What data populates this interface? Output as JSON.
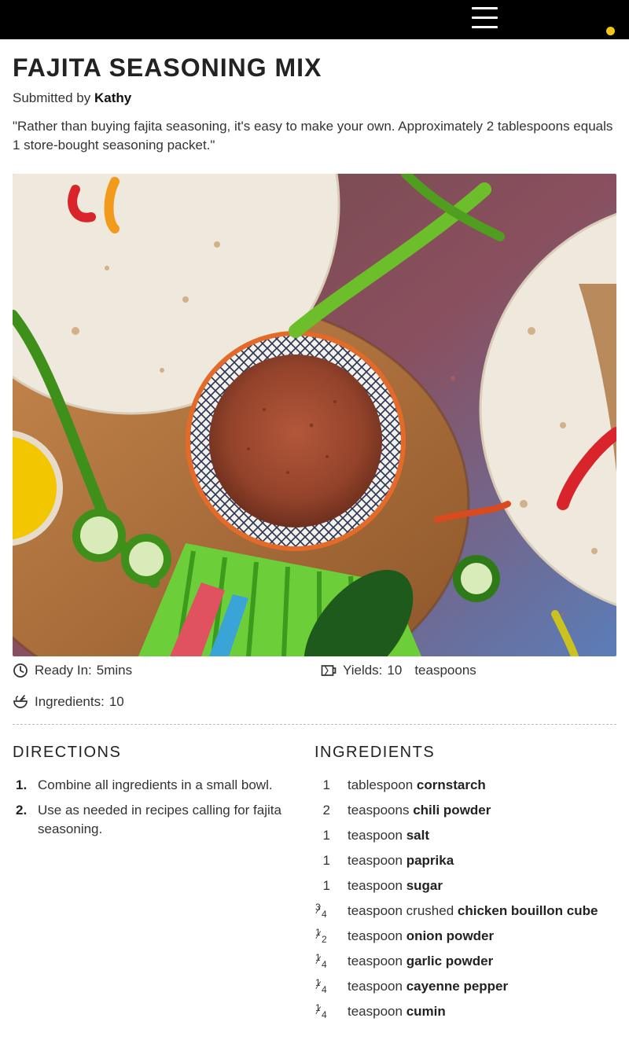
{
  "header": {
    "menu_icon": "hamburger-menu-icon",
    "accent_color": "#f5c518"
  },
  "recipe": {
    "title": "FAJITA SEASONING MIX",
    "submitted_by_label": "Submitted by",
    "author": "Kathy",
    "description": "\"Rather than buying fajita seasoning, it's easy to make your own. Approximately 2 tablespoons equals 1 store-bought seasoning packet.\"",
    "image_icon": "recipe-photo"
  },
  "meta": {
    "ready_in_label": "Ready In:",
    "ready_in_value": "5mins",
    "yields_label": "Yields:",
    "yields_value": "10",
    "yields_unit": "teaspoons",
    "ingredients_label": "Ingredients:",
    "ingredients_value": "10"
  },
  "directions": {
    "heading": "DIRECTIONS",
    "steps": [
      {
        "num": "1.",
        "text": "Combine all ingredients in a small bowl."
      },
      {
        "num": "2.",
        "text": "Use as needed in recipes calling for fajita seasoning."
      }
    ]
  },
  "ingredients": {
    "heading": "INGREDIENTS",
    "items": [
      {
        "qty": "1",
        "unit": "tablespoon",
        "name": "cornstarch"
      },
      {
        "qty": "2",
        "unit": "teaspoons",
        "name": "chili powder"
      },
      {
        "qty": "1",
        "unit": "teaspoon",
        "name": "salt"
      },
      {
        "qty": "1",
        "unit": "teaspoon",
        "name": "paprika"
      },
      {
        "qty": "1",
        "unit": "teaspoon",
        "name": "sugar"
      },
      {
        "qty_num": "3",
        "qty_den": "4",
        "unit": "teaspoon crushed",
        "name": "chicken bouillon cube"
      },
      {
        "qty_num": "1",
        "qty_den": "2",
        "unit": "teaspoon",
        "name": "onion powder"
      },
      {
        "qty_num": "1",
        "qty_den": "4",
        "unit": "teaspoon",
        "name": "garlic powder"
      },
      {
        "qty_num": "1",
        "qty_den": "4",
        "unit": "teaspoon",
        "name": "cayenne pepper"
      },
      {
        "qty_num": "1",
        "qty_den": "4",
        "unit": "teaspoon",
        "name": "cumin"
      }
    ]
  }
}
